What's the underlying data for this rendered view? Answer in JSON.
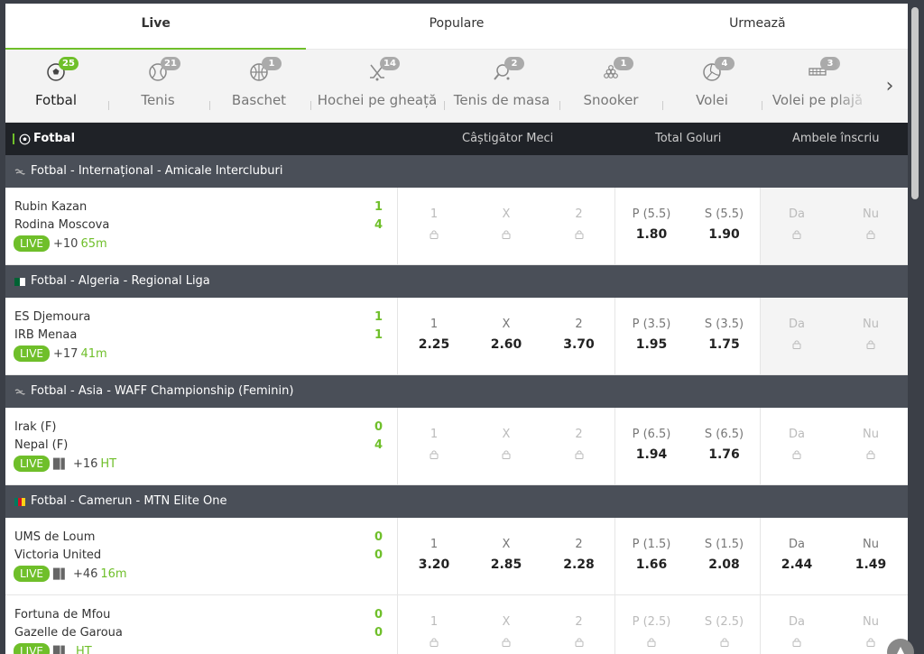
{
  "tabs": [
    "Live",
    "Populare",
    "Urmează"
  ],
  "sports": [
    {
      "label": "Fotbal",
      "count": "25",
      "icon": "soccer-ball-icon"
    },
    {
      "label": "Tenis",
      "count": "21",
      "icon": "tennis-ball-icon"
    },
    {
      "label": "Baschet",
      "count": "1",
      "icon": "basketball-icon"
    },
    {
      "label": "Hochei pe gheață",
      "count": "14",
      "icon": "hockey-sticks-icon"
    },
    {
      "label": "Tenis de masa",
      "count": "2",
      "icon": "table-tennis-icon"
    },
    {
      "label": "Snooker",
      "count": "1",
      "icon": "snooker-balls-icon"
    },
    {
      "label": "Volei",
      "count": "4",
      "icon": "volleyball-icon"
    },
    {
      "label": "Volei pe plajă",
      "count": "3",
      "icon": "beach-volleyball-icon"
    }
  ],
  "header": {
    "sport": "Fotbal",
    "col_winner": "Câștigător Meci",
    "col_goals": "Total Goluri",
    "col_btts": "Ambele înscriu"
  },
  "leagues": [
    {
      "title": "Fotbal - Internațional - Amicale Intercluburi",
      "flag": "world"
    },
    {
      "title": "Fotbal - Algeria - Regional Liga",
      "flag": "algeria"
    },
    {
      "title": "Fotbal - Asia - WAFF Championship (Feminin)",
      "flag": "world"
    },
    {
      "title": "Fotbal - Camerun - MTN Elite One",
      "flag": "cameroon"
    }
  ],
  "matches": [
    {
      "home": "Rubin Kazan",
      "away": "Rodina Moscova",
      "score_home": "1",
      "score_away": "4",
      "live": "LIVE",
      "more": "+10",
      "time": "65m",
      "stats": false,
      "odds": [
        {
          "n": "1",
          "v": ""
        },
        {
          "n": "X",
          "v": ""
        },
        {
          "n": "2",
          "v": ""
        },
        {
          "n": "P (5.5)",
          "v": "1.80"
        },
        {
          "n": "S (5.5)",
          "v": "1.90"
        },
        {
          "n": "Da",
          "v": ""
        },
        {
          "n": "Nu",
          "v": ""
        }
      ]
    },
    {
      "home": "ES Djemoura",
      "away": "IRB Menaa",
      "score_home": "1",
      "score_away": "1",
      "live": "LIVE",
      "more": "+17",
      "time": "41m",
      "stats": false,
      "odds": [
        {
          "n": "1",
          "v": "2.25"
        },
        {
          "n": "X",
          "v": "2.60"
        },
        {
          "n": "2",
          "v": "3.70"
        },
        {
          "n": "P (3.5)",
          "v": "1.95"
        },
        {
          "n": "S (3.5)",
          "v": "1.75"
        },
        {
          "n": "Da",
          "v": ""
        },
        {
          "n": "Nu",
          "v": ""
        }
      ]
    },
    {
      "home": "Irak (F)",
      "away": "Nepal (F)",
      "score_home": "0",
      "score_away": "4",
      "live": "LIVE",
      "more": "+16",
      "time": "HT",
      "stats": true,
      "odds": [
        {
          "n": "1",
          "v": ""
        },
        {
          "n": "X",
          "v": ""
        },
        {
          "n": "2",
          "v": ""
        },
        {
          "n": "P (6.5)",
          "v": "1.94"
        },
        {
          "n": "S (6.5)",
          "v": "1.76"
        },
        {
          "n": "Da",
          "v": ""
        },
        {
          "n": "Nu",
          "v": ""
        }
      ]
    },
    {
      "home": "UMS de Loum",
      "away": "Victoria United",
      "score_home": "0",
      "score_away": "0",
      "live": "LIVE",
      "more": "+46",
      "time": "16m",
      "stats": true,
      "odds": [
        {
          "n": "1",
          "v": "3.20"
        },
        {
          "n": "X",
          "v": "2.85"
        },
        {
          "n": "2",
          "v": "2.28"
        },
        {
          "n": "P (1.5)",
          "v": "1.66"
        },
        {
          "n": "S (1.5)",
          "v": "2.08"
        },
        {
          "n": "Da",
          "v": "2.44"
        },
        {
          "n": "Nu",
          "v": "1.49"
        }
      ]
    },
    {
      "home": "Fortuna de Mfou",
      "away": "Gazelle de Garoua",
      "score_home": "0",
      "score_away": "0",
      "live": "LIVE",
      "more": "",
      "time": "HT",
      "stats": true,
      "odds": [
        {
          "n": "1",
          "v": ""
        },
        {
          "n": "X",
          "v": ""
        },
        {
          "n": "2",
          "v": ""
        },
        {
          "n": "P (2.5)",
          "v": ""
        },
        {
          "n": "S (2.5)",
          "v": ""
        },
        {
          "n": "Da",
          "v": ""
        },
        {
          "n": "Nu",
          "v": ""
        }
      ]
    }
  ],
  "colors": {
    "accent": "#6fbf2a",
    "header_bg": "#1f2227",
    "league_bg": "#4a4f58"
  }
}
